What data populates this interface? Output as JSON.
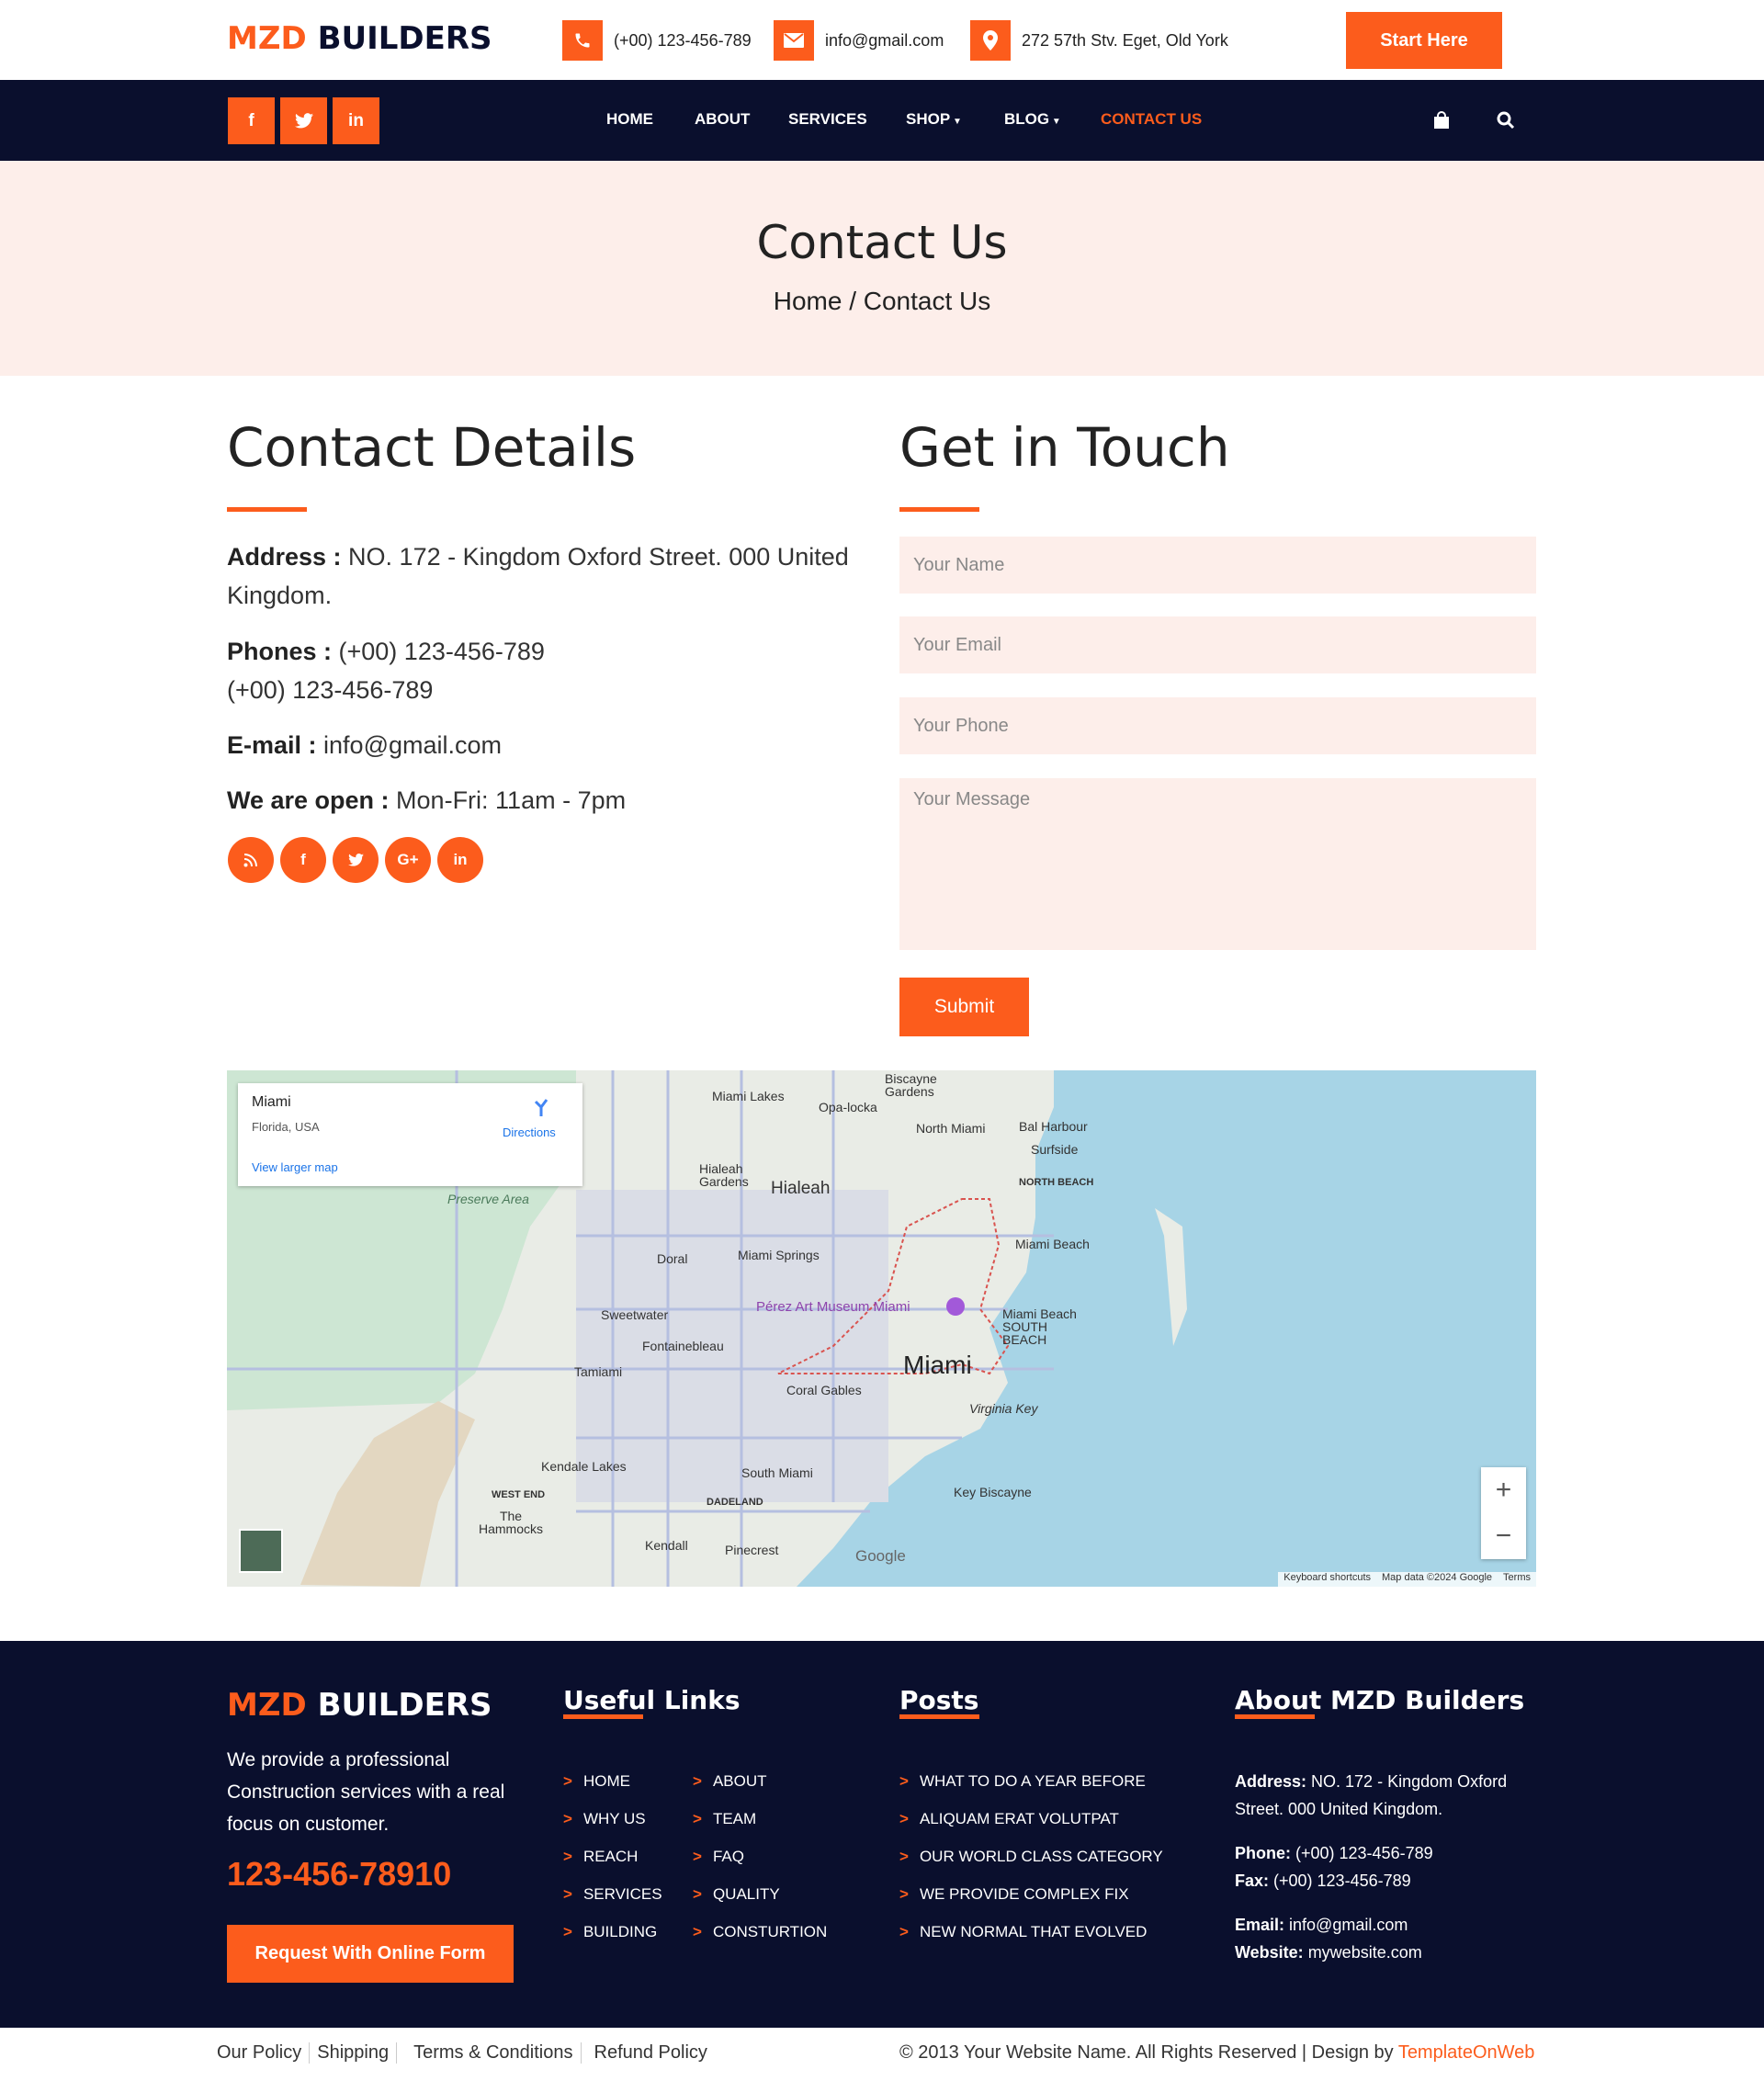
{
  "brand": {
    "orange": "MZD",
    "dark": "BUILDERS"
  },
  "topbar": {
    "phone": "(+00) 123-456-789",
    "email": "info@gmail.com",
    "address": "272 57th Stv. Eget, Old York",
    "start_label": "Start Here"
  },
  "nav": {
    "social": [
      "f",
      "t",
      "in"
    ],
    "items": [
      "HOME",
      "ABOUT",
      "SERVICES",
      "SHOP",
      "BLOG",
      "CONTACT US"
    ],
    "active": "CONTACT US"
  },
  "banner": {
    "title": "Contact Us",
    "breadcrumb": "Home / Contact Us"
  },
  "contact_details": {
    "heading": "Contact Details",
    "address_label": "Address :",
    "address_value": " NO. 172 - Kingdom Oxford Street. 000 United Kingdom.",
    "phones_label": "Phones :",
    "phone1": " (+00) 123-456-789",
    "phone2": "(+00) 123-456-789",
    "email_label": "E-mail :",
    "email_value": " info@gmail.com",
    "open_label": "We are open :",
    "open_value": " Mon-Fri: 11am - 7pm",
    "social": [
      "rss",
      "f",
      "t",
      "G+",
      "in"
    ]
  },
  "form": {
    "heading": "Get in Touch",
    "name_placeholder": "Your Name",
    "email_placeholder": "Your Email",
    "phone_placeholder": "Your Phone",
    "message_placeholder": "Your Message",
    "submit_label": "Submit"
  },
  "map": {
    "card_title": "Miami",
    "card_sub": "Florida, USA",
    "directions": "Directions",
    "larger": "View larger map",
    "labels": [
      "Miami Lakes",
      "Opa-locka",
      "Biscayne Gardens",
      "North Miami",
      "Bal Harbour",
      "Surfside",
      "NORTH BEACH",
      "Hialeah Gardens",
      "Hialeah",
      "Miami Beach",
      "Doral",
      "Miami Springs",
      "Pérez Art Museum Miami",
      "Sweetwater",
      "Fontainebleau",
      "Miami Beach SOUTH BEACH",
      "Tamiami",
      "Miami",
      "Coral Gables",
      "Virginia Key",
      "Kendale Lakes",
      "South Miami",
      "WEST END",
      "DADELAND",
      "Key Biscayne",
      "The Hammocks",
      "Kendall",
      "Pinecrest",
      "Preserve Area"
    ],
    "google": "Google",
    "attribution": [
      "Keyboard shortcuts",
      "Map data ©2024 Google",
      "Terms"
    ]
  },
  "footer": {
    "about_text": "We provide a professional Construction services with a real focus on customer.",
    "phone_big": "123-456-78910",
    "request_label": "Request With Online Form",
    "useful_heading": "Useful Links",
    "useful_col1": [
      "HOME",
      "WHY US",
      "REACH",
      "SERVICES",
      "BUILDING"
    ],
    "useful_col2": [
      "ABOUT",
      "TEAM",
      "FAQ",
      "QUALITY",
      "CONSTURTION"
    ],
    "posts_heading": "Posts",
    "posts": [
      "WHAT TO DO A YEAR BEFORE",
      "ALIQUAM ERAT VOLUTPAT",
      "OUR WORLD CLASS CATEGORY",
      "WE PROVIDE COMPLEX FIX",
      "NEW NORMAL THAT EVOLVED"
    ],
    "about_heading": "About MZD Builders",
    "address_label": "Address:",
    "address_value": " NO. 172 - Kingdom Oxford Street. 000 United Kingdom.",
    "phone_label": "Phone:",
    "phone_value": " (+00) 123-456-789",
    "fax_label": "Fax:",
    "fax_value": " (+00) 123-456-789",
    "email_label": "Email:",
    "email_value": " info@gmail.com",
    "website_label": "Website:",
    "website_value": " mywebsite.com"
  },
  "bottom": {
    "links": [
      "Our Policy",
      "Shipping",
      "Terms & Conditions",
      "Refund Policy"
    ],
    "copyright": "© 2013 Your Website Name. All Rights Reserved | Design by ",
    "designer": "TemplateOnWeb"
  },
  "colors": {
    "accent": "#fc5c1c",
    "navy": "#0a0f2d",
    "banner_bg": "#fdeeea"
  }
}
